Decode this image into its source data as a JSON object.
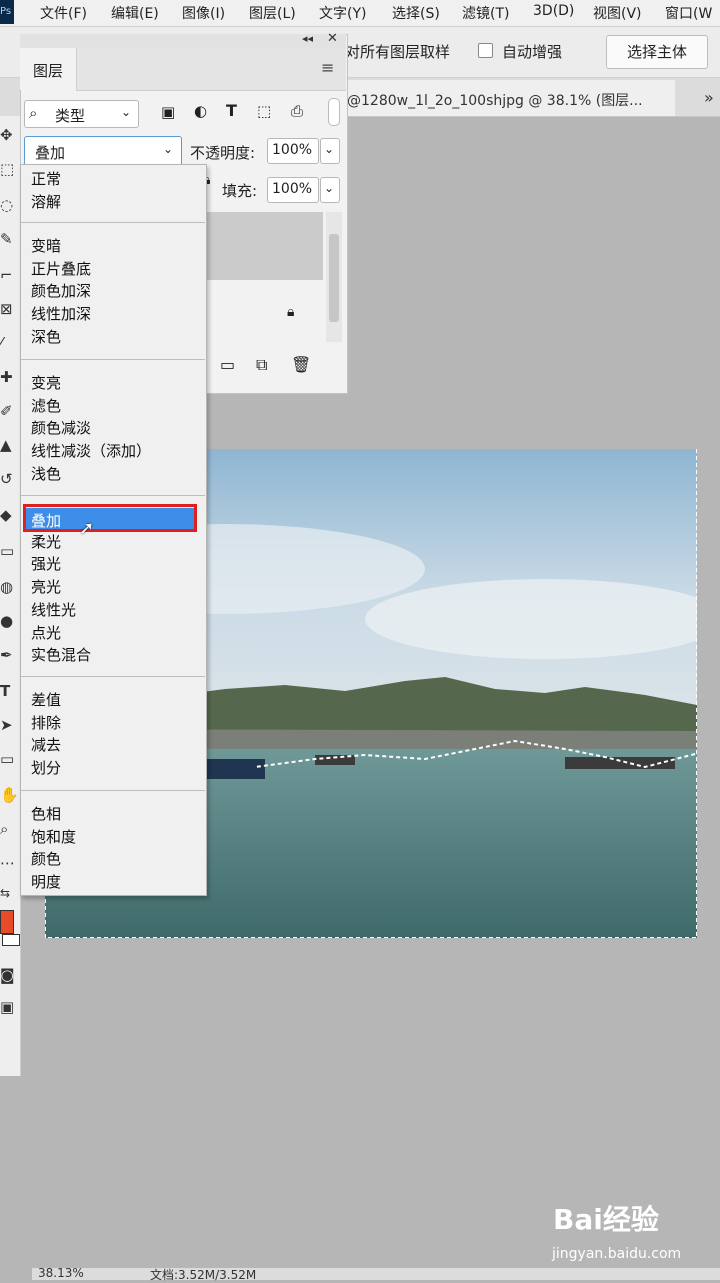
{
  "menubar": {
    "items": [
      "文件(F)",
      "编辑(E)",
      "图像(I)",
      "图层(L)",
      "文字(Y)",
      "选择(S)",
      "滤镜(T)",
      "3D(D)",
      "视图(V)",
      "窗口(W"
    ]
  },
  "options": {
    "sample_all_layers": "对所有图层取样",
    "auto_enhance": "自动增强",
    "select_subject": "选择主体"
  },
  "document_tab": {
    "title": "@1280w_1l_2o_100shjpg @ 38.1% (图层...",
    "overflow": "»"
  },
  "layers_panel": {
    "title": "图层",
    "filter_kind": "类型",
    "blend_mode": "叠加",
    "opacity_label": "不透明度:",
    "opacity_value": "100%",
    "fill_label": "填充:",
    "fill_value": "100%"
  },
  "blend_menu": {
    "groups": [
      [
        "正常",
        "溶解"
      ],
      [
        "变暗",
        "正片叠底",
        "颜色加深",
        "线性加深",
        "深色"
      ],
      [
        "变亮",
        "滤色",
        "颜色减淡",
        "线性减淡（添加）",
        "浅色"
      ],
      [
        "叠加",
        "柔光",
        "强光",
        "亮光",
        "线性光",
        "点光",
        "实色混合"
      ],
      [
        "差值",
        "排除",
        "减去",
        "划分"
      ],
      [
        "色相",
        "饱和度",
        "颜色",
        "明度"
      ]
    ],
    "selected": "叠加"
  },
  "colors": {
    "highlight": "#3d8ee8",
    "highlight_border": "#e02020",
    "foreground_swatch": "#e84a2a"
  },
  "status": {
    "zoom": "38.13%",
    "doc_size": "文档:3.52M/3.52M"
  },
  "watermark": {
    "brand": "Bai经验",
    "url": "jingyan.baidu.com"
  }
}
